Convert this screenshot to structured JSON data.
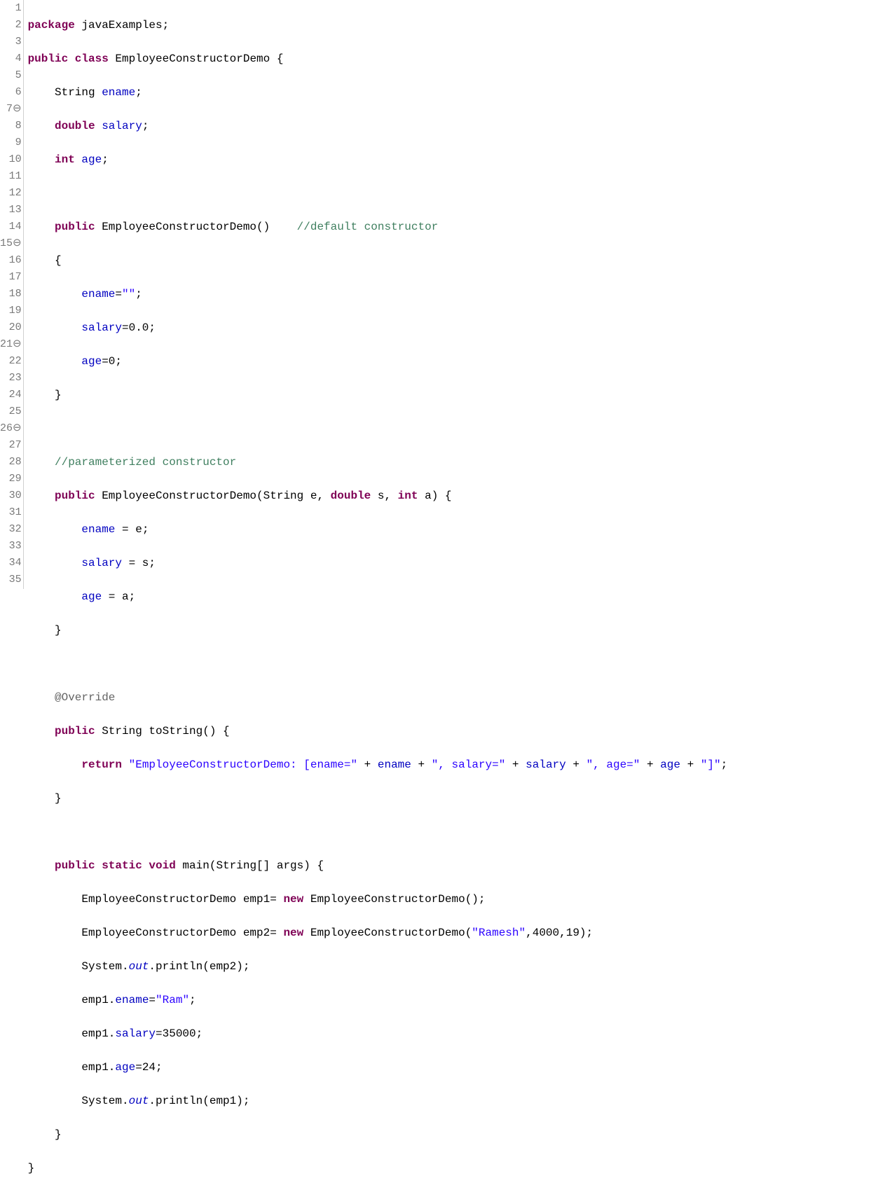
{
  "lineNumbers": [
    "1",
    "2",
    "3",
    "4",
    "5",
    "6",
    "7⊖",
    "8",
    "9",
    "10",
    "11",
    "12",
    "13",
    "14",
    "15⊖",
    "16",
    "17",
    "18",
    "19",
    "20",
    "21⊖",
    "22",
    "23",
    "24",
    "25",
    "26⊖",
    "27",
    "28",
    "29",
    "30",
    "31",
    "32",
    "33",
    "34",
    "35"
  ],
  "tokens": {
    "package": "package",
    "public": "public",
    "class": "class",
    "double": "double",
    "int": "int",
    "new": "new",
    "return": "return",
    "static": "static",
    "void": "void",
    "pkgName": " javaExamples;",
    "classDecl": " EmployeeConstructorDemo {",
    "stringType": "    String ",
    "enameDecl": "ename",
    "salaryDecl": "salary",
    "ageDecl": "age",
    "semicolon": ";",
    "defCtorSig": " EmployeeConstructorDemo()    ",
    "defCtorCm": "//default constructor",
    "brace_open_i1": "    {",
    "ctorBody_ename_pre": "        ",
    "ctorBody_ename_field": "ename",
    "ctorBody_ename_post": "=",
    "emptyStr": "\"\"",
    "ctorBody_salary_post": "=0.0;",
    "ctorBody_age_post": "=0;",
    "brace_close_i1": "    }",
    "paramCtorCm": "    //parameterized constructor",
    "paramCtorSig_a": " EmployeeConstructorDemo(String e, ",
    "paramCtorSig_b": " s, ",
    "paramCtorSig_c": " a) {",
    "paramBody_ename": " = e;",
    "paramBody_salary": " = s;",
    "paramBody_age": " = a;",
    "override": "    @Override",
    "toStringSig": " String toString() {",
    "retIndent": "        ",
    "toStr_s1": "\"EmployeeConstructorDemo: [ename=\"",
    "toStr_plus": " + ",
    "toStr_s2": "\", salary=\"",
    "toStr_s3": "\", age=\"",
    "toStr_s4": "\"]\"",
    "mainSig_a": " main(String[] args) {",
    "main_l1_a": "        EmployeeConstructorDemo emp1= ",
    "main_l1_b": " EmployeeConstructorDemo();",
    "main_l2_a": "        EmployeeConstructorDemo emp2= ",
    "main_l2_b": " EmployeeConstructorDemo(",
    "main_l2_str": "\"Ramesh\"",
    "main_l2_c": ",4000,19);",
    "sys": "        System.",
    "out": "out",
    "println_emp2": ".println(emp2);",
    "println_emp1": ".println(emp1);",
    "emp1_pre": "        emp1.",
    "emp1_ename_eq": "=",
    "ramStr": "\"Ram\"",
    "emp1_salary_post": "=35000;",
    "emp1_age_post": "=24;",
    "brace_close_root": "}",
    "indent1": "    ",
    "indent2": "        "
  }
}
